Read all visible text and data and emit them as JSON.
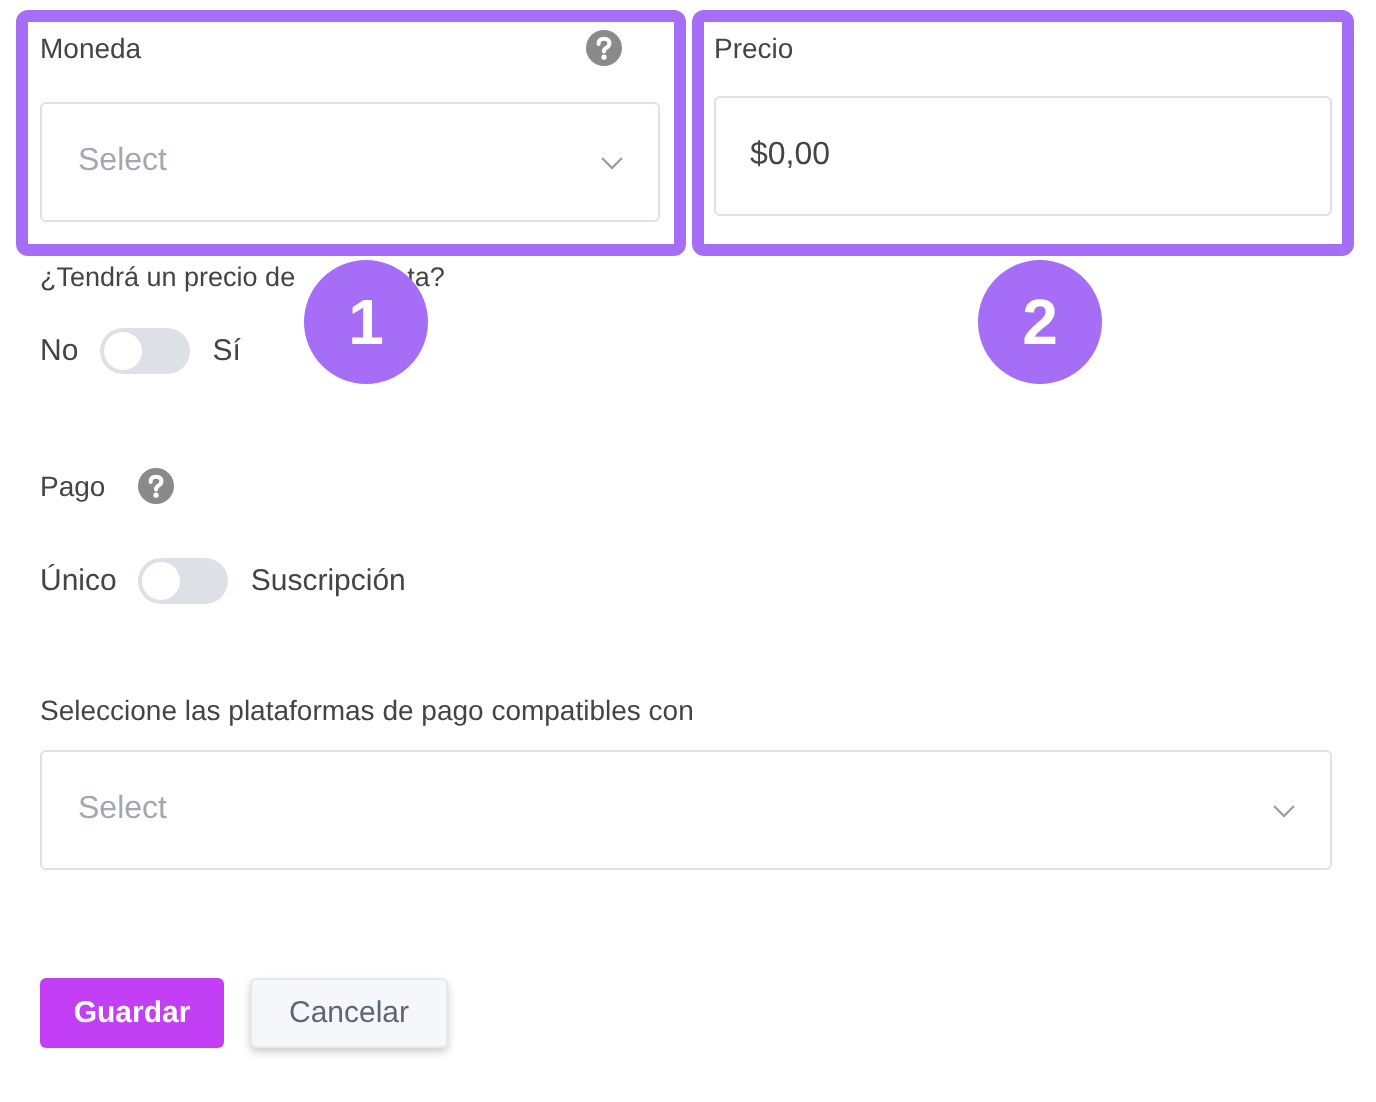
{
  "currency": {
    "label": "Moneda",
    "placeholder": "Select"
  },
  "price": {
    "label": "Precio",
    "value": "$0,00"
  },
  "sale_price": {
    "label_start": "¿Tendrá un precio de",
    "label_end": "ta?",
    "off_label": "No",
    "on_label": "Sí",
    "on": false
  },
  "payment": {
    "label": "Pago",
    "off_label": "Único",
    "on_label": "Suscripción",
    "on": false
  },
  "platforms": {
    "label": "Seleccione las plataformas de pago compatibles con",
    "placeholder": "Select"
  },
  "buttons": [
    {
      "label": "Guardar",
      "kind": "primary"
    },
    {
      "label": "Cancelar",
      "kind": "secondary"
    }
  ],
  "annotations": [
    {
      "number": "1"
    },
    {
      "number": "2"
    }
  ]
}
